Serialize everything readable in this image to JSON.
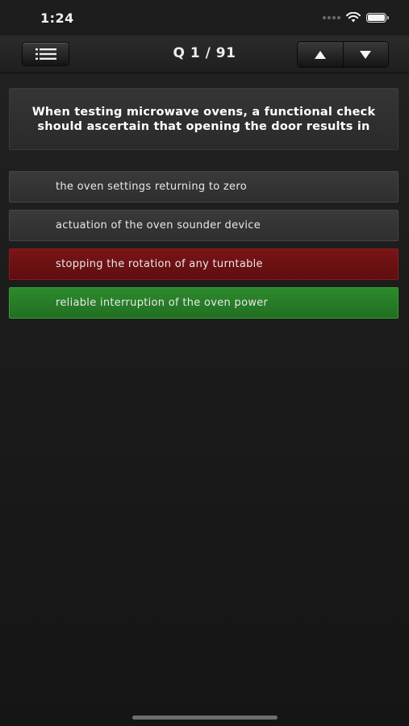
{
  "status_bar": {
    "time": "1:24"
  },
  "nav": {
    "title": "Q 1 / 91",
    "icons": {
      "menu": "list-icon",
      "previous": "arrow-up-icon",
      "next": "arrow-down-icon"
    }
  },
  "question": {
    "text": "When testing microwave ovens, a functional check should ascertain that opening the door results in"
  },
  "answers": [
    {
      "text": "the oven settings returning to zero",
      "state": "neutral"
    },
    {
      "text": "actuation of the oven sounder device",
      "state": "neutral"
    },
    {
      "text": "stopping the rotation of any turntable",
      "state": "wrong"
    },
    {
      "text": "reliable interruption of the oven power",
      "state": "correct"
    }
  ],
  "colors": {
    "background": "#1b1b1b",
    "neutral_answer": "#333333",
    "wrong_answer": "#6d1113",
    "correct_answer": "#277d27"
  }
}
